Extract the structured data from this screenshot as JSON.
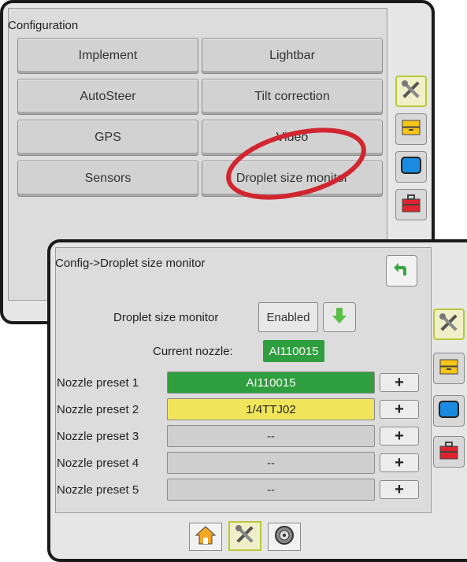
{
  "configuration": {
    "title": "Configuration",
    "buttons": [
      "Implement",
      "Lightbar",
      "AutoSteer",
      "Tilt correction",
      "GPS",
      "Video",
      "Sensors",
      "Droplet size monitor"
    ]
  },
  "sidebar_icons": [
    "tools-icon",
    "storage-icon",
    "display-icon",
    "toolbox-icon"
  ],
  "droplet_panel": {
    "title": "Config->Droplet size monitor",
    "monitor_label": "Droplet size monitor",
    "monitor_value": "Enabled",
    "current_nozzle_label": "Current nozzle:",
    "current_nozzle_value": "AI110015",
    "presets": [
      {
        "label": "Nozzle preset 1",
        "value": "AI110015",
        "color": "#2e9e3e",
        "text_color": "#ffffff"
      },
      {
        "label": "Nozzle preset 2",
        "value": "1/4TTJ02",
        "color": "#f0e55a",
        "text_color": "#222222"
      },
      {
        "label": "Nozzle preset 3",
        "value": "--",
        "color": "#cfcfcf",
        "text_color": "#555555"
      },
      {
        "label": "Nozzle preset 4",
        "value": "--",
        "color": "#cfcfcf",
        "text_color": "#555555"
      },
      {
        "label": "Nozzle preset 5",
        "value": "--",
        "color": "#cfcfcf",
        "text_color": "#555555"
      }
    ],
    "plus_label": "+"
  },
  "bottom_tabs": [
    "home-icon",
    "tools-icon",
    "settings-icon"
  ],
  "highlight_color": "#d1262f"
}
